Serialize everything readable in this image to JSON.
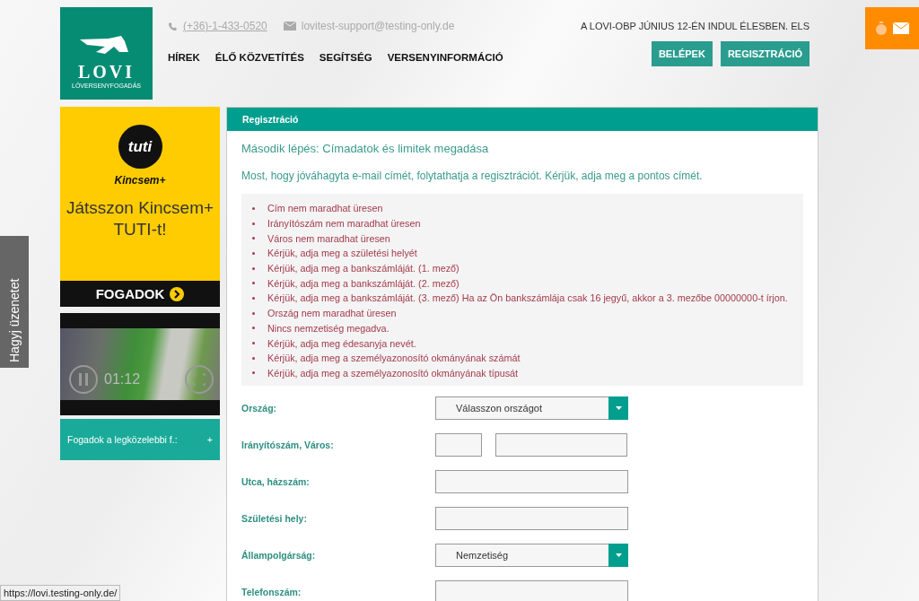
{
  "header": {
    "phone": "(+36)-1-433-0520",
    "email": "lovitest-support@testing-only.de",
    "logo_text": "LOVI",
    "logo_subtitle": "LÓVERSENYFOGADÁS",
    "ticker": "A LOVI-OBP JÚNIUS 12-ÉN INDUL ÉLESBEN. ELS",
    "nav": [
      "HÍREK",
      "ÉLŐ KÖZVETÍTÉS",
      "SEGÍTSÉG",
      "VERSENYINFORMÁCIÓ"
    ],
    "buttons": [
      "BELÉPEK",
      "REGISZTRÁCIÓ"
    ]
  },
  "feedback_tab": {
    "label": "Hagyj üzenetet"
  },
  "sidebar": {
    "ad": {
      "logo": "tuti",
      "brand": "Kincsem+",
      "headline": "Játsszon Kincsem+ TUTI-t!",
      "cta": "FOGADOK"
    },
    "video": {
      "time": "01:12"
    },
    "next_race": {
      "label": "Fogadok a legközelebbi f.:",
      "toggle": "+"
    }
  },
  "panel": {
    "title": "Regisztráció",
    "step": "Második lépés: Címadatok és limitek megadása",
    "intro": "Most, hogy jóváhagyta e-mail címét, folytathatja a regisztrációt. Kérjük, adja meg a pontos címét.",
    "errors": [
      "Cím nem maradhat üresen",
      "Irányítószám nem maradhat üresen",
      "Város nem maradhat üresen",
      "Kérjük, adja meg a születési helyét",
      "Kérjük, adja meg a bankszámláját. (1. mező)",
      "Kérjük, adja meg a bankszámláját. (2. mező)",
      "Kérjük, adja meg a bankszámláját. (3. mező) Ha az Ön bankszámlája csak 16 jegyű, akkor a 3. mezőbe 00000000-t írjon.",
      "Ország nem maradhat üresen",
      "Nincs nemzetiség megadva.",
      "Kérjük, adja meg édesanyja nevét.",
      "Kérjük, adja meg a személyazonosító okmányának számát",
      "Kérjük, adja meg a személyazonosító okmányának típusát"
    ],
    "form": [
      {
        "label": "Ország:",
        "kind": "select",
        "value": "Válasszon országot"
      },
      {
        "label": "Irányítószám, Város:",
        "kind": "pair"
      },
      {
        "label": "Utca, házszám:",
        "kind": "text"
      },
      {
        "label": "Születési hely:",
        "kind": "text"
      },
      {
        "label": "Állampolgárság:",
        "kind": "select",
        "value": "Nemzetiség"
      },
      {
        "label": "Telefonszám:",
        "kind": "text"
      }
    ]
  },
  "status_url": "https://lovi.testing-only.de/"
}
